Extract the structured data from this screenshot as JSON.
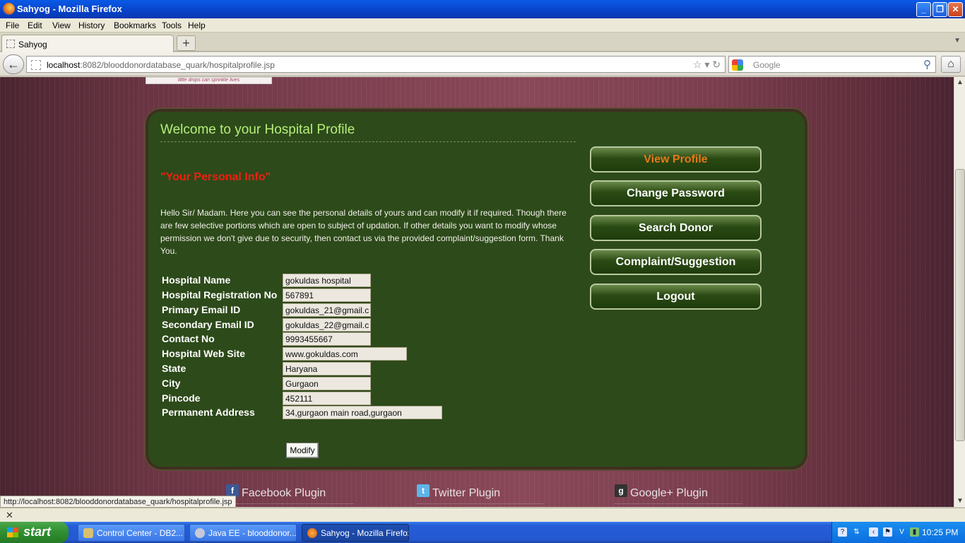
{
  "window": {
    "title": "Sahyog - Mozilla Firefox"
  },
  "menu": [
    "File",
    "Edit",
    "View",
    "History",
    "Bookmarks",
    "Tools",
    "Help"
  ],
  "tab": {
    "label": "Sahyog",
    "new_tab": "+"
  },
  "nav": {
    "url_host": "localhost",
    "url_rest": ":8082/blooddonordatabase_quark/hospitalprofile.jsp",
    "search_placeholder": "Google"
  },
  "page": {
    "logo_caption": "little drops can sprinkle lives",
    "welcome": "Welcome to your Hospital Profile",
    "info_heading": "\"Your Personal Info\"",
    "intro": "Hello Sir/ Madam. Here you can see the personal details of yours and can modify it if required. Though there are few selective portions which are open to subject of updation. If other details you want to modify whose permission we don't give due to security, then contact us via the provided complaint/suggestion form. Thank You.",
    "fields": [
      {
        "label": "Hospital Name",
        "value": "gokuldas hospital"
      },
      {
        "label": "Hospital Registration No",
        "value": "567891"
      },
      {
        "label": "Primary Email ID",
        "value": "gokuldas_21@gmail.c"
      },
      {
        "label": "Secondary Email ID",
        "value": "gokuldas_22@gmail.c"
      },
      {
        "label": "Contact No",
        "value": "9993455667"
      },
      {
        "label": "Hospital Web Site",
        "value": "www.gokuldas.com"
      },
      {
        "label": "State",
        "value": "Haryana"
      },
      {
        "label": "City",
        "value": "Gurgaon"
      },
      {
        "label": "Pincode",
        "value": "452111"
      },
      {
        "label": "Permanent Address",
        "value": "34,gurgaon main road,gurgaon"
      }
    ],
    "modify": "Modify",
    "side_buttons": [
      "View Profile",
      "Change Password",
      "Search Donor",
      "Complaint/Suggestion",
      "Logout"
    ],
    "social": [
      "Facebook Plugin",
      "Twitter Plugin",
      "Google+ Plugin"
    ]
  },
  "status_url": "http://localhost:8082/blooddonordatabase_quark/hospitalprofile.jsp",
  "addon_close": "✕",
  "taskbar": {
    "start": "start",
    "tasks": [
      "Control Center - DB2...",
      "Java EE - blooddonor...",
      "Sahyog - Mozilla Firefox"
    ],
    "clock": "10:25 PM"
  },
  "colors": {
    "panel": "#2d4a1a",
    "welcome": "#b6ee7a",
    "heading": "#ee2010",
    "active_button": "#e8781a"
  }
}
